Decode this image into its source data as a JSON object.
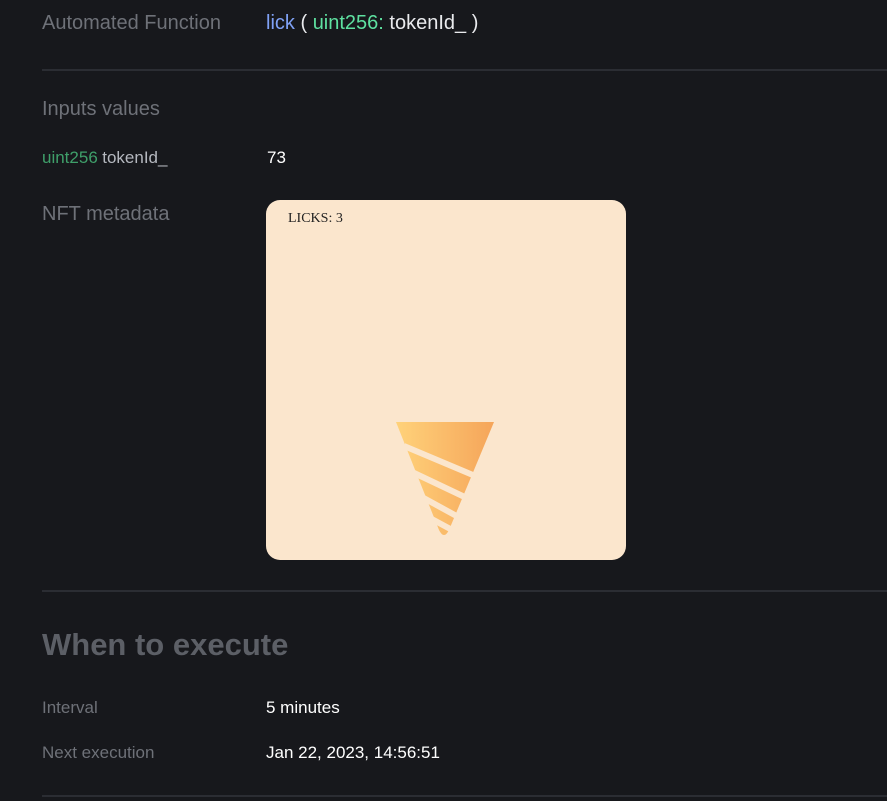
{
  "automated_function": {
    "label": "Automated Function",
    "name": "lick",
    "open_paren": "(",
    "param_type": "uint256:",
    "param_name": "tokenId_",
    "close_paren": ")"
  },
  "inputs": {
    "title": "Inputs values",
    "rows": [
      {
        "type": "uint256",
        "name": "tokenId_",
        "value": "73"
      }
    ]
  },
  "nft": {
    "label": "NFT metadata",
    "licks_text": "LICKS: 3",
    "background": "#fbe6cd",
    "cone_gradient_start": "#ffd27a",
    "cone_gradient_end": "#f5a55a"
  },
  "schedule": {
    "heading": "When to execute",
    "interval_label": "Interval",
    "interval_value": "5 minutes",
    "next_label": "Next execution",
    "next_value": "Jan 22, 2023, 14:56:51"
  }
}
